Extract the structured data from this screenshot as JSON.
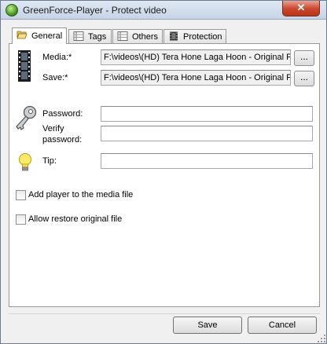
{
  "window": {
    "title": "GreenForce-Player - Protect video",
    "close_label": "✕"
  },
  "tabs": [
    {
      "label": "General",
      "icon": "folder-open-icon",
      "active": true
    },
    {
      "label": "Tags",
      "icon": "list-icon",
      "active": false
    },
    {
      "label": "Others",
      "icon": "list-icon",
      "active": false
    },
    {
      "label": "Protection",
      "icon": "film-icon",
      "active": false
    }
  ],
  "general": {
    "media_label": "Media:*",
    "media_value": "F:\\videos\\(HD) Tera Hone Laga Hoon - Original F",
    "save_label": "Save:*",
    "save_value": "F:\\videos\\(HD) Tera Hone Laga Hoon - Original F",
    "browse_label": "...",
    "password_label": "Password:",
    "password_value": "",
    "verify_label_line1": "Verify",
    "verify_label_line2": "password:",
    "verify_value": "",
    "tip_label": "Tip:",
    "tip_value": "",
    "add_player_label": "Add player to the media file",
    "add_player_checked": false,
    "allow_restore_label": "Allow restore original file",
    "allow_restore_checked": false
  },
  "footer": {
    "save_button": "Save",
    "cancel_button": "Cancel"
  }
}
